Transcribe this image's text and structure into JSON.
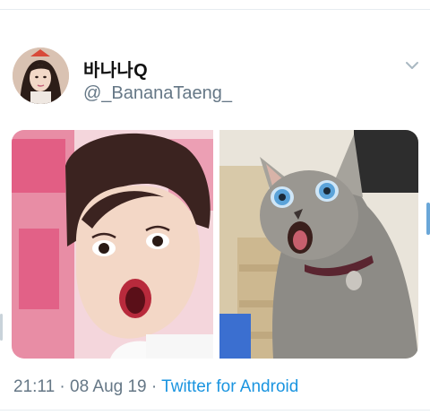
{
  "tweet": {
    "display_name": "바나나Q",
    "handle": "@_BananaTaeng_",
    "time": "21:11",
    "separator_1": "·",
    "date": "08 Aug 19",
    "separator_2": "·",
    "source": "Twitter for Android"
  },
  "icons": {
    "more": "chevron-down-icon"
  },
  "colors": {
    "link": "#1b95e0",
    "secondary_text": "#657786",
    "rule": "#e6ecf0"
  }
}
